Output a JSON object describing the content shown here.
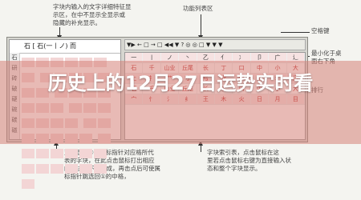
{
  "annotations": {
    "top_left": "字块内输入的文字详细特征显\n示区，在中不显示全显示或\n隐藏的补充显示。",
    "top_mid": "功能列表区",
    "right_1": "空格键",
    "right_2": "最小化于桌\n面右下角",
    "right_3": "排行",
    "bottom_left": "变动显示①中鼠标指针对应格所代\n表的字块，在此点击鼠标打出相应\n的字块，不再生成，再击点后可使属\n标指针跳选回①的中格，",
    "bottom_right": "字块索引表，点击鼠标在这\n里若点击鼠标右键为直接输入状\n态和整个字块显示。"
  },
  "left_panel": {
    "header": "石 [ 石(一丨ノ) 而",
    "side_chars": [
      "石",
      "研",
      "砖",
      "破",
      "硬",
      "碗",
      "碳",
      "磁"
    ]
  },
  "toolbar": {
    "text": "▼▶ ← □ → □ ◀◀ ▼ ? ◎ ◎ □ ▼ ▼ ▼"
  },
  "right_grid": {
    "rows": [
      [
        "一",
        "丨",
        "ノ",
        "丶",
        "乙",
        "亻",
        "冫",
        "卩",
        "广",
        "辶"
      ],
      [
        "石",
        "千",
        "山业",
        "丘尾",
        "长",
        "丁",
        "口",
        "中",
        "小",
        "大"
      ],
      [
        "土",
        "扌",
        "艹",
        "寸",
        "弓",
        "女",
        "巾",
        "彳",
        "犭",
        "门"
      ],
      [
        "石",
        "千",
        "山业",
        "丘尾",
        "长",
        "丁",
        "口",
        "中",
        "小",
        "大"
      ],
      [
        "宀",
        "忄",
        "氵",
        "纟",
        "王",
        "木",
        "火",
        "日",
        "月",
        "目"
      ]
    ]
  },
  "title": "历史上的12月27日运势实时看",
  "colors": {
    "banner": "#d6827880",
    "title": "#ffffff"
  }
}
